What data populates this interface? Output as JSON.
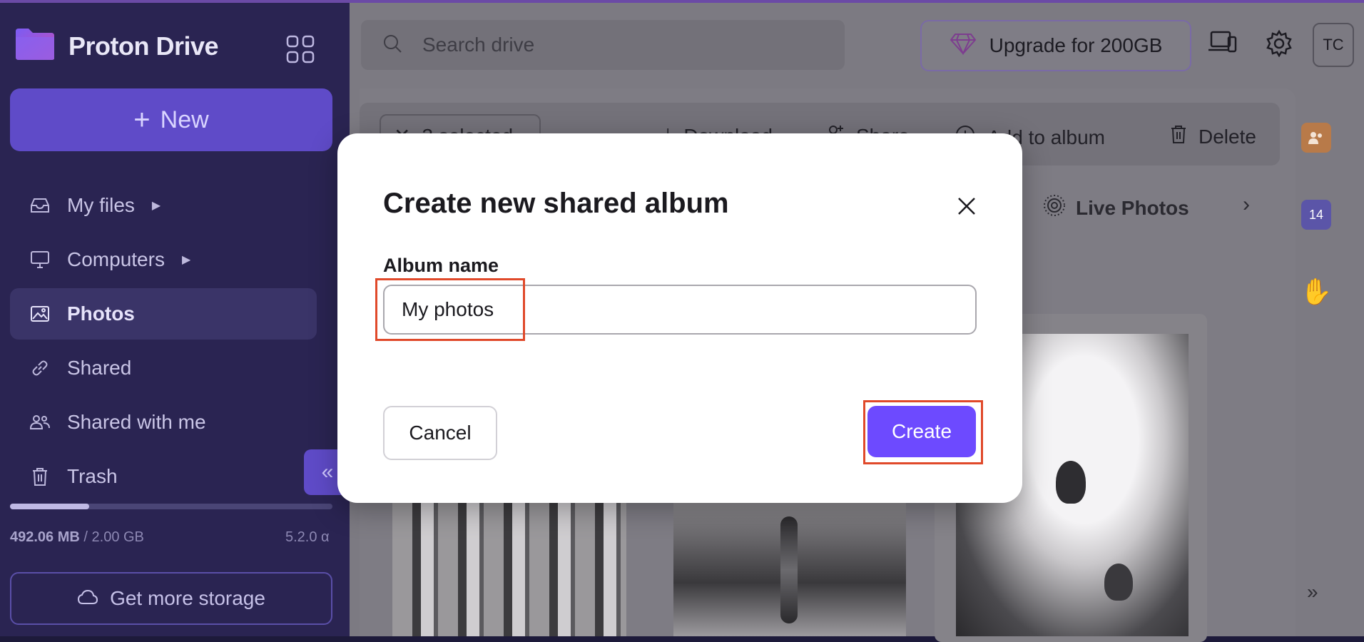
{
  "sidebar": {
    "brand": "Proton Drive",
    "new_label": "New",
    "items": [
      {
        "label": "My files"
      },
      {
        "label": "Computers"
      },
      {
        "label": "Photos"
      },
      {
        "label": "Shared"
      },
      {
        "label": "Shared with me"
      },
      {
        "label": "Trash"
      }
    ],
    "storage_used": "492.06 MB",
    "storage_total": " / 2.00 GB",
    "storage_fraction": 0.246,
    "version": "5.2.0 α",
    "get_more_storage": "Get more storage"
  },
  "header": {
    "search_placeholder": "Search drive",
    "upgrade_label": "Upgrade for 200GB",
    "avatar_initials": "TC"
  },
  "toolbar": {
    "selected_label": "3 selected",
    "download_label": "Download",
    "share_label": "Share",
    "add_to_album_label": "Add to album",
    "delete_label": "Delete"
  },
  "filters": {
    "live_photos_label": "Live Photos"
  },
  "right_rail": {
    "calendar_day": "14"
  },
  "modal": {
    "title": "Create new shared album",
    "field_label": "Album name",
    "album_name_value": "My photos",
    "cancel_label": "Cancel",
    "create_label": "Create"
  },
  "colors": {
    "sidebar_bg": "#2a2452",
    "accent": "#6d4aff",
    "highlight": "#e0492a"
  }
}
